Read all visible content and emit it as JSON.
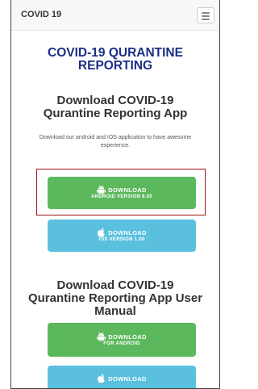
{
  "navbar": {
    "brand": "COVID 19"
  },
  "page": {
    "title": "COVID-19 QURANTINE REPORTING"
  },
  "app_section": {
    "heading": "Download COVID-19 Qurantine Reporting App",
    "description": "Download our android and IOS application to have awesome experience.",
    "android_button": {
      "label": "DOWNLOAD",
      "sublabel": "ANDROID VERSION 6.00",
      "color": "#5cb85c"
    },
    "ios_button": {
      "label": "DOWNLOAD",
      "sublabel": "IOS VERSION 1.00",
      "color": "#5bc0de"
    }
  },
  "manual_section": {
    "heading": "Download COVID-19 Qurantine Reporting App User Manual",
    "android_button": {
      "label": "DOWNLOAD",
      "sublabel": "FOR ANDROID"
    },
    "ios_button": {
      "label": "DOWNLOAD"
    }
  },
  "icons": [
    "android-icon",
    "apple-icon",
    "hamburger-menu-icon"
  ],
  "highlight_color": "#a01212"
}
